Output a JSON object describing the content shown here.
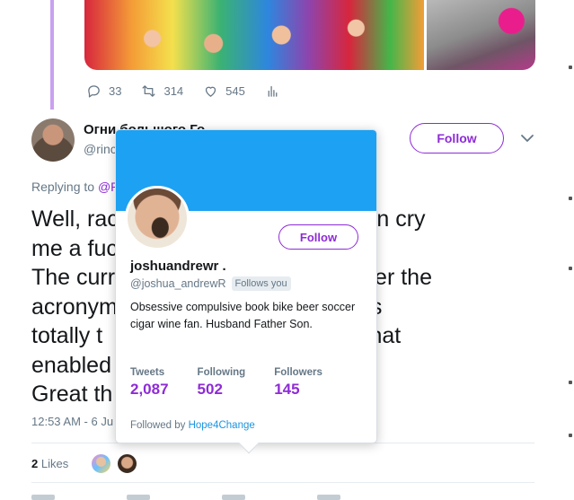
{
  "prev_tweet": {
    "actions": {
      "reply_count": "33",
      "retweet_count": "314",
      "like_count": "545"
    }
  },
  "tweet": {
    "author_name": "Огни большого Го",
    "author_handle": "@rinc",
    "follow_label": "Follow",
    "replying_prefix": "Replying to",
    "replying_handle": "@P",
    "text_lines": [
      "Well, rac                             eties can cry",
      "me a fuc",
      "The curr                            r whatever the",
      "acronym                            alogue is",
      "totally t                            latforms that",
      "enabled                              them.",
      "Great th"
    ],
    "timestamp": "12:53 AM - 6 Ju",
    "likes_count": "2",
    "likes_label": "Likes"
  },
  "hovercard": {
    "name": "joshuandrewr .",
    "handle": "@joshua_andrewR",
    "follows_you": "Follows you",
    "follow_label": "Follow",
    "bio": "Obsessive compulsive book bike beer soccer cigar wine fan. Husband Father Son.",
    "stats": [
      {
        "label": "Tweets",
        "value": "2,087"
      },
      {
        "label": "Following",
        "value": "502"
      },
      {
        "label": "Followers",
        "value": "145"
      }
    ],
    "followed_by_prefix": "Followed by",
    "followed_by_name": "Hope4Change"
  },
  "colors": {
    "accent": "#8e2bd6",
    "header_blue": "#1da1f2",
    "muted": "#657786"
  }
}
